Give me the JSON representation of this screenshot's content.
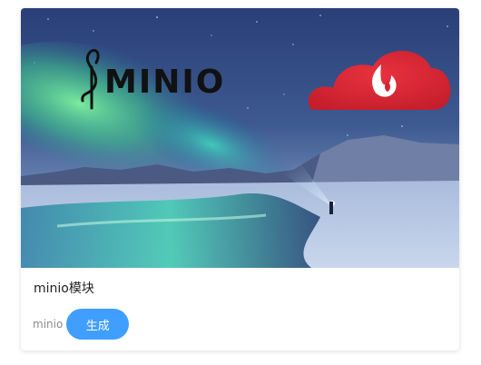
{
  "card": {
    "title": "minio模块",
    "tag": "minio",
    "generate_label": "生成"
  },
  "cover": {
    "logo_text": "MINIO",
    "colors": {
      "sky_top": "#2a3f77",
      "aurora": "#5fe09a",
      "snow": "#c9d6ec",
      "cloud": "#d62433"
    }
  }
}
